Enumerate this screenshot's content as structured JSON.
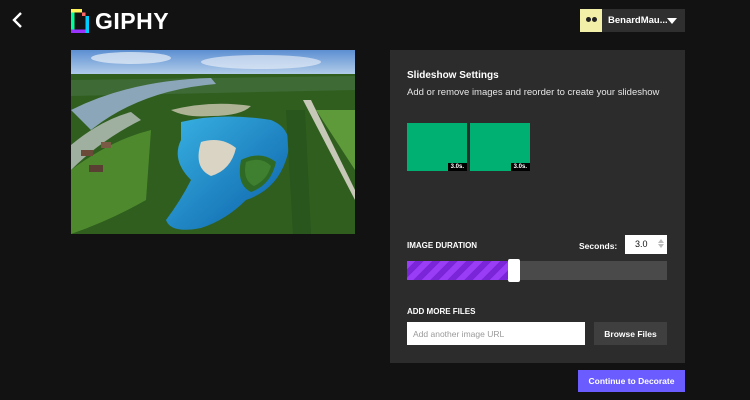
{
  "header": {
    "back_icon": "back-chevron-icon",
    "logo_text": "GIPHY",
    "logo_icon": "giphy-logo-icon",
    "user": {
      "name": "BenardMau...",
      "avatar_icon": "avatar-icon",
      "menu_icon": "caret-down-icon"
    }
  },
  "preview": {
    "image_icon": "aerial-lake-photo"
  },
  "settings": {
    "title": "Slideshow Settings",
    "description": "Add or remove images and reorder to create your slideshow",
    "thumbnails": [
      {
        "duration": "3.0s."
      },
      {
        "duration": "3.0s."
      }
    ],
    "duration_label": "IMAGE DURATION",
    "seconds_label": "Seconds:",
    "seconds_value": "3.0",
    "slider_fraction": 0.4,
    "add_files_label": "ADD MORE FILES",
    "url_placeholder": "Add another image URL",
    "browse_label": "Browse Files"
  },
  "continue_label": "Continue to Decorate",
  "colors": {
    "background": "#121212",
    "panel": "#2c2c2c",
    "thumb_green": "#00b073",
    "slider_purple": "#9a3df7",
    "primary_button": "#6a5cff"
  }
}
